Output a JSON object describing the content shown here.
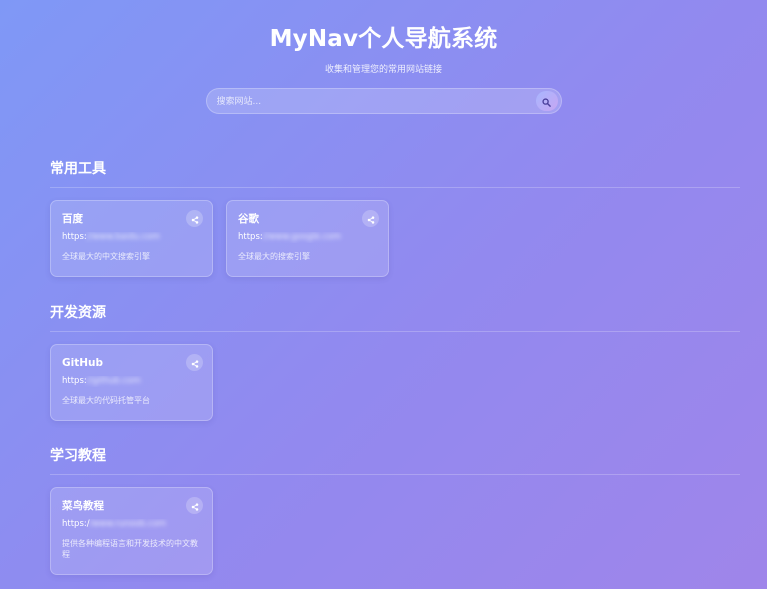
{
  "header": {
    "title": "MyNav个人导航系统",
    "subtitle": "收集和管理您的常用网站链接"
  },
  "search": {
    "placeholder": "搜索网站...",
    "button_icon": "search-icon"
  },
  "sections": [
    {
      "title": "常用工具",
      "links": [
        {
          "name": "百度",
          "url_prefix": "https:",
          "url_rest": "//www.baidu.com",
          "desc": "全球最大的中文搜索引擎",
          "icon": "share-icon"
        },
        {
          "name": "谷歌",
          "url_prefix": "https:",
          "url_rest": "//www.google.com",
          "desc": "全球最大的搜索引擎",
          "icon": "share-icon"
        }
      ]
    },
    {
      "title": "开发资源",
      "links": [
        {
          "name": "GitHub",
          "url_prefix": "https:",
          "url_rest": "//github.com",
          "desc": "全球最大的代码托管平台",
          "icon": "share-icon"
        }
      ]
    },
    {
      "title": "学习教程",
      "links": [
        {
          "name": "菜鸟教程",
          "url_prefix": "https:/",
          "url_rest": "/www.runoob.com",
          "desc": "提供各种编程语言和开发技术的中文教程",
          "icon": "share-icon"
        }
      ]
    }
  ],
  "colors": {
    "background_start": "#7f98f6",
    "background_end": "#9f85ea",
    "text": "#ffffff"
  }
}
